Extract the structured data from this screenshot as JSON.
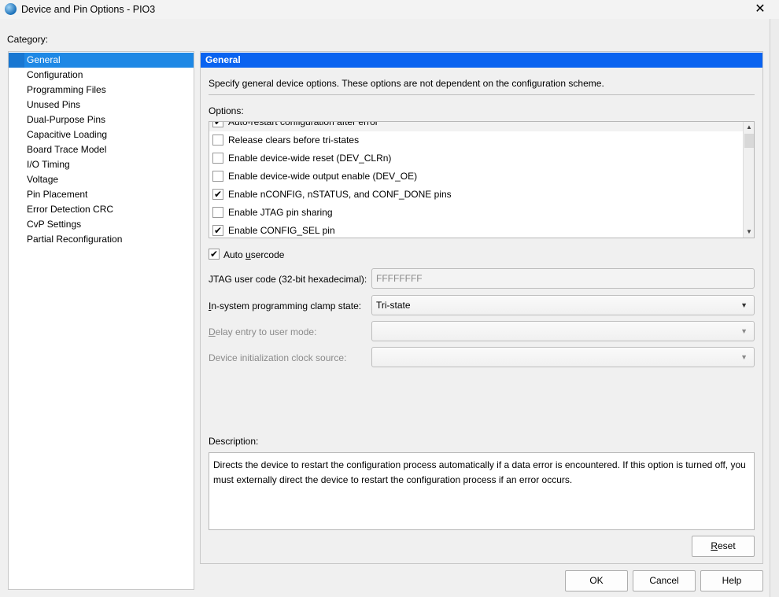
{
  "window": {
    "title": "Device and Pin Options - PIO3",
    "close": "✕"
  },
  "category": {
    "label": "Category:",
    "items": [
      "General",
      "Configuration",
      "Programming Files",
      "Unused Pins",
      "Dual-Purpose Pins",
      "Capacitive Loading",
      "Board Trace Model",
      "I/O Timing",
      "Voltage",
      "Pin Placement",
      "Error Detection CRC",
      "CvP Settings",
      "Partial Reconfiguration"
    ],
    "selected": "General"
  },
  "panel": {
    "header": "General",
    "description": "Specify general device options. These options are not dependent on the configuration scheme.",
    "options_label": "Options:",
    "options": [
      {
        "label": "Auto-restart configuration after error",
        "checked": true
      },
      {
        "label": "Release clears before tri-states",
        "checked": false
      },
      {
        "label": "Enable device-wide reset (DEV_CLRn)",
        "checked": false
      },
      {
        "label": "Enable device-wide output enable (DEV_OE)",
        "checked": false
      },
      {
        "label": "Enable nCONFIG, nSTATUS, and CONF_DONE pins",
        "checked": true
      },
      {
        "label": "Enable JTAG pin sharing",
        "checked": false
      },
      {
        "label": "Enable CONFIG_SEL pin",
        "checked": true
      }
    ],
    "auto_usercode": {
      "pre": "Auto ",
      "u": "u",
      "post": "sercode",
      "checked": true
    },
    "jtag_label": "JTAG user code (32-bit hexadecimal):",
    "jtag_value": "FFFFFFFF",
    "clamp_label_u": "I",
    "clamp_label": "n-system programming clamp state:",
    "clamp_value": "Tri-state",
    "delay_label_u": "D",
    "delay_label": "elay entry to user mode:",
    "delay_value": "",
    "clock_label": "Device initialization clock source:",
    "clock_value": "",
    "description_label": "Description:",
    "description_text": "Directs the device to restart the configuration process automatically if a data error is encountered. If this option is turned off, you must externally direct the device to restart the configuration process if an error occurs.",
    "reset_u": "R",
    "reset": "eset"
  },
  "buttons": {
    "ok": "OK",
    "cancel": "Cancel",
    "help": "Help"
  }
}
